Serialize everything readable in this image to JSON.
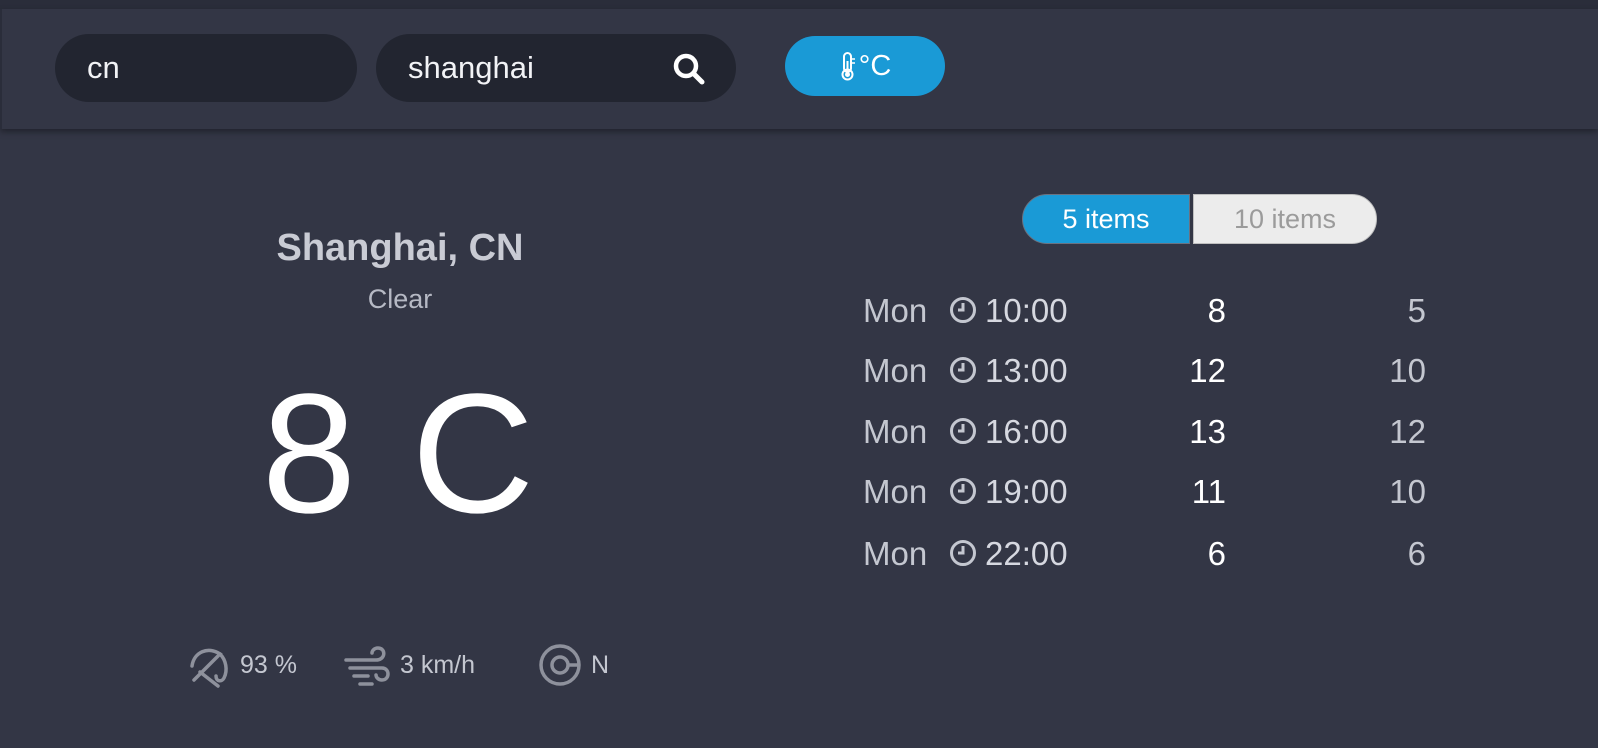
{
  "search": {
    "country_value": "cn",
    "city_value": "shanghai",
    "unit_label": "°C"
  },
  "current": {
    "location": "Shanghai, CN",
    "condition": "Clear",
    "temperature": "8 C",
    "humidity": "93 %",
    "wind_speed": "3 km/h",
    "wind_direction": "N"
  },
  "toggle": {
    "five_label": "5 items",
    "ten_label": "10 items",
    "selected": "5 items"
  },
  "forecast": [
    {
      "day": "Mon",
      "time": "10:00",
      "hi": "8",
      "lo": "5"
    },
    {
      "day": "Mon",
      "time": "13:00",
      "hi": "12",
      "lo": "10"
    },
    {
      "day": "Mon",
      "time": "16:00",
      "hi": "13",
      "lo": "12"
    },
    {
      "day": "Mon",
      "time": "19:00",
      "hi": "11",
      "lo": "10"
    },
    {
      "day": "Mon",
      "time": "22:00",
      "hi": "6",
      "lo": "6"
    }
  ],
  "colors": {
    "background": "#333645",
    "accent": "#1a9ad6",
    "input_bg": "#222530"
  },
  "icons": [
    "search-icon",
    "thermometer-icon",
    "umbrella-icon",
    "wind-icon",
    "compass-icon",
    "clock-icon"
  ]
}
